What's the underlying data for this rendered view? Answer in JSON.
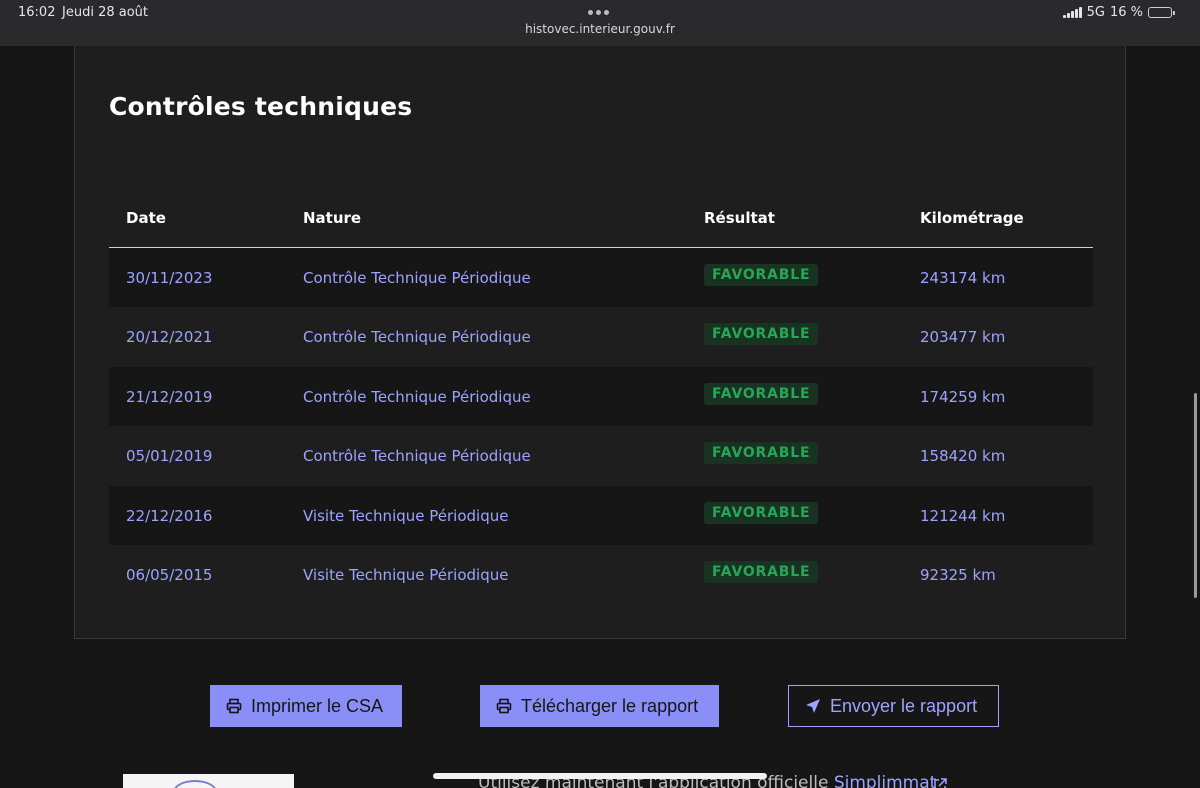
{
  "status_bar": {
    "time": "16:02",
    "date": "Jeudi 28 août",
    "url": "histovec.interieur.gouv.fr",
    "network": "5G",
    "battery": "16 %",
    "battery_level": 0.16
  },
  "section": {
    "title": "Contrôles techniques"
  },
  "table": {
    "headers": {
      "date": "Date",
      "nature": "Nature",
      "result": "Résultat",
      "mileage": "Kilométrage"
    },
    "rows": [
      {
        "date": "30/11/2023",
        "nature": "Contrôle Technique Périodique",
        "result": "FAVORABLE",
        "mileage": "243174 km"
      },
      {
        "date": "20/12/2021",
        "nature": "Contrôle Technique Périodique",
        "result": "FAVORABLE",
        "mileage": "203477 km"
      },
      {
        "date": "21/12/2019",
        "nature": "Contrôle Technique Périodique",
        "result": "FAVORABLE",
        "mileage": "174259 km"
      },
      {
        "date": "05/01/2019",
        "nature": "Contrôle Technique Périodique",
        "result": "FAVORABLE",
        "mileage": "158420 km"
      },
      {
        "date": "22/12/2016",
        "nature": "Visite Technique Périodique",
        "result": "FAVORABLE",
        "mileage": "121244 km"
      },
      {
        "date": "06/05/2015",
        "nature": "Visite Technique Périodique",
        "result": "FAVORABLE",
        "mileage": "92325 km"
      }
    ]
  },
  "actions": {
    "print_csa": "Imprimer le CSA",
    "download_report": "Télécharger le rapport",
    "send_report": "Envoyer le rapport"
  },
  "promo": {
    "text": "Utilisez maintenant l'application officielle ",
    "link": "Simplimmat"
  },
  "icons": {
    "print": "printer-icon",
    "send": "send-icon",
    "external": "external-link-icon"
  },
  "colors": {
    "accent": "#8a8ff8",
    "link": "#9da3ff",
    "success_text": "#27a658",
    "success_bg": "#193322",
    "background": "#161616"
  }
}
